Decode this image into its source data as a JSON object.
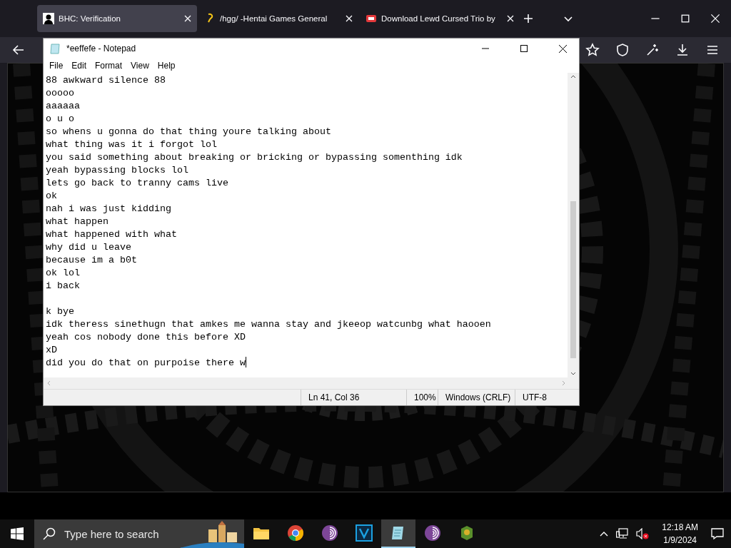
{
  "browser": {
    "tabs": [
      {
        "title": "BHC: Verification",
        "selected": true,
        "kind": "user"
      },
      {
        "title": "/hgg/ -Hentai Games General",
        "selected": false,
        "kind": "link"
      },
      {
        "title": "Download Lewd Cursed Trio by",
        "selected": false,
        "kind": "game"
      }
    ]
  },
  "notepad": {
    "title": "*eeffefe - Notepad",
    "menu": [
      "File",
      "Edit",
      "Format",
      "View",
      "Help"
    ],
    "lines": [
      {
        "kind": "text",
        "text": "88 awkward silence 88"
      },
      {
        "kind": "text",
        "text": "ooooo"
      },
      {
        "kind": "text",
        "text": "aaaaaa"
      },
      {
        "kind": "text",
        "text": "o u o"
      },
      {
        "kind": "text",
        "text": "so whens u gonna do that thing youre talking about"
      },
      {
        "kind": "text",
        "text": "what thing was it i forgot lol"
      },
      {
        "kind": "text",
        "text": "you said something about breaking or bricking or bypassing somenthing idk"
      },
      {
        "kind": "text",
        "text": "yeah bypassing blocks lol"
      },
      {
        "kind": "text",
        "text": "lets go back to tranny cams live"
      },
      {
        "kind": "text",
        "text": "ok"
      },
      {
        "kind": "text",
        "text": "nah i was just kidding"
      },
      {
        "kind": "text",
        "text": "what happen"
      },
      {
        "kind": "text",
        "text": "what happened with what"
      },
      {
        "kind": "text",
        "text": "why did u leave"
      },
      {
        "kind": "text",
        "text": "because im a b0t"
      },
      {
        "kind": "text",
        "text": "ok lol"
      },
      {
        "kind": "text",
        "text": "i back"
      },
      {
        "kind": "blank"
      },
      {
        "kind": "text",
        "text": "k bye"
      },
      {
        "kind": "text",
        "text": "idk theress sinethugn that amkes me wanna stay and jkeeop watcunbg what haooen"
      },
      {
        "kind": "text",
        "text": "yeah cos nobody done this before XD"
      },
      {
        "kind": "text",
        "text": "xD"
      },
      {
        "kind": "text",
        "text": "did you do that on purpoise there w"
      }
    ],
    "status": [
      "Ln 41, Col 36",
      "100%",
      "Windows (CRLF)",
      "UTF-8"
    ]
  },
  "taskbar": {
    "search": {
      "placeholder": "Type here to search"
    },
    "apps": [
      {
        "kind": "folder",
        "selected": false
      },
      {
        "kind": "chrome",
        "selected": false
      },
      {
        "kind": "tor",
        "selected": false
      },
      {
        "kind": "editor",
        "selected": false
      },
      {
        "kind": "notepad",
        "selected": true
      },
      {
        "kind": "tor",
        "selected": false
      },
      {
        "kind": "game",
        "selected": false
      }
    ],
    "time": "12:18 AM",
    "date": "1/9/2024"
  }
}
